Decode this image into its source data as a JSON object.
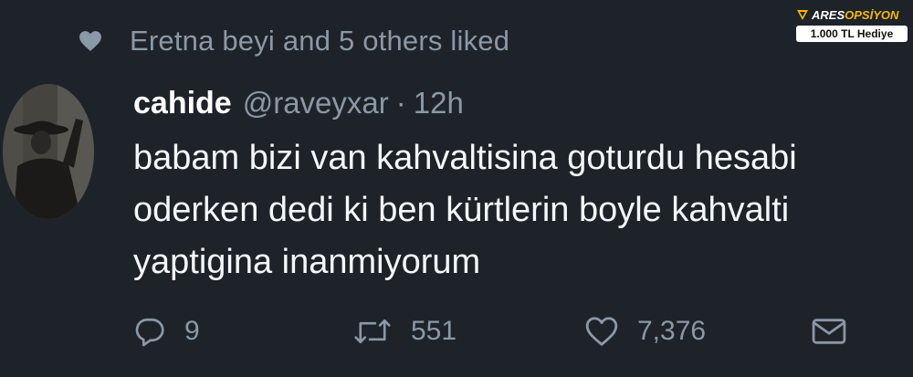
{
  "social_context": {
    "text": "Eretna beyi and 5 others liked",
    "icon": "heart-icon"
  },
  "tweet": {
    "display_name": "cahide",
    "handle": "@raveyxar",
    "separator": "·",
    "time": "12h",
    "text_lines": [
      "babam bizi van kahvaltisina goturdu hesabi",
      "oderken dedi ki ben kürtlerin boyle kahvalti",
      "yaptigina inanmiyorum"
    ]
  },
  "actions": {
    "reply": {
      "count": "9",
      "icon": "reply-icon"
    },
    "retweet": {
      "count": "551",
      "icon": "retweet-icon"
    },
    "like": {
      "count": "7,376",
      "icon": "heart-outline-icon"
    },
    "dm": {
      "icon": "envelope-icon"
    }
  },
  "watermark": {
    "brand_prefix": "ARES",
    "brand_suffix": "OPSİYON",
    "offer": "1.000 TL Hediye",
    "accent": "#f5b800"
  },
  "colors": {
    "background": "#1e232a",
    "secondary_text": "#8b98a5",
    "primary_text": "#f5f8fa"
  }
}
